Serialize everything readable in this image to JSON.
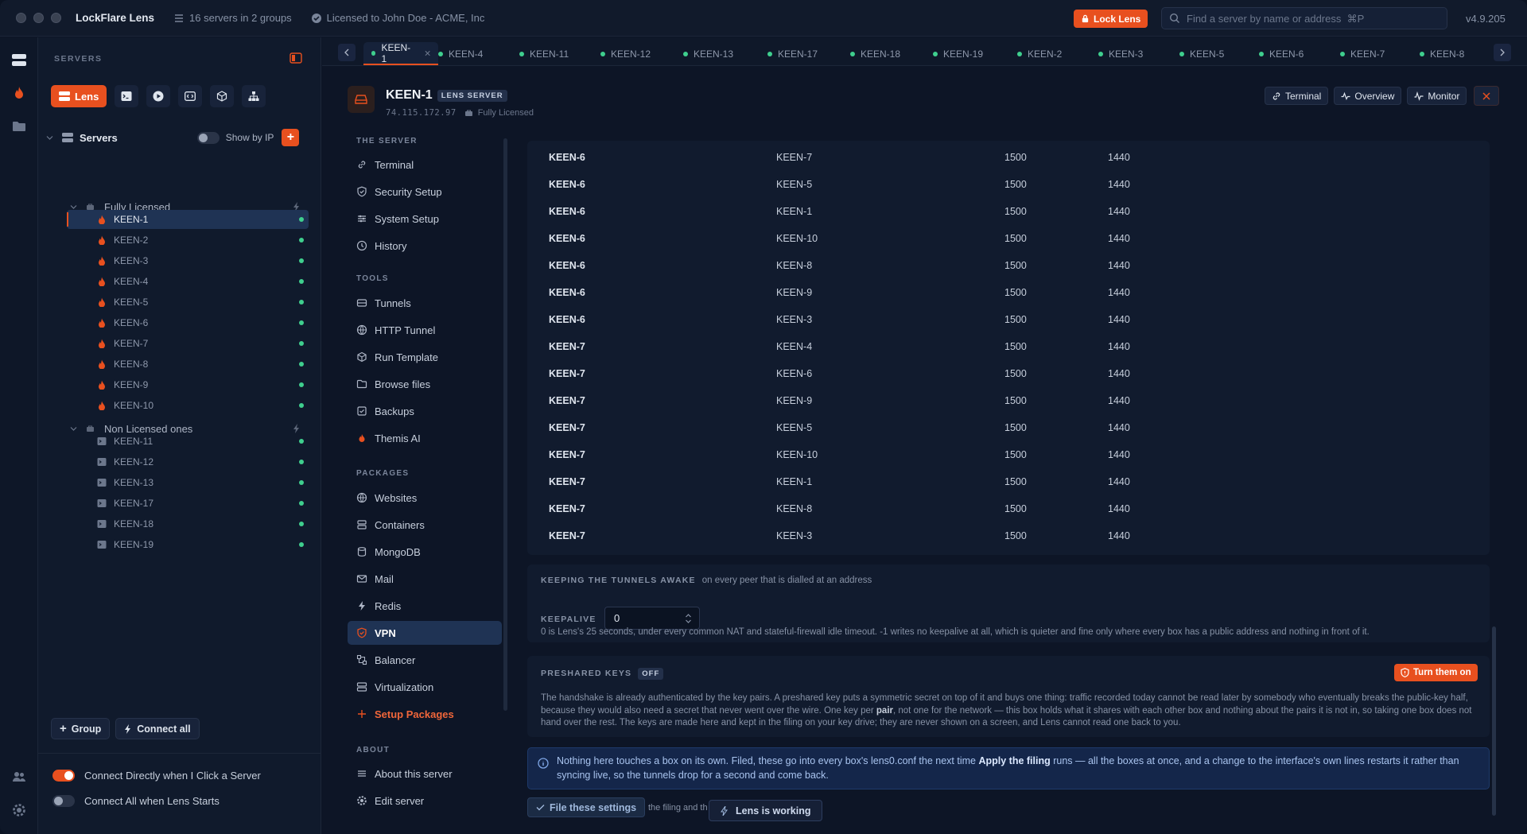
{
  "titlebar": {
    "app_name": "LockFlare Lens",
    "servers_summary": "16 servers in 2 groups",
    "license": "Licensed to John Doe - ACME, Inc",
    "lock_label": "Lock Lens",
    "search_placeholder": "Find a server by name or address  ⌘P",
    "version": "v4.9.205"
  },
  "sidebar": {
    "header": "SERVERS",
    "lens_label": "Lens",
    "servers_label": "Servers",
    "show_by_ip": "Show by IP",
    "groups": [
      {
        "name": "Fully Licensed",
        "items": [
          "KEEN-1",
          "KEEN-2",
          "KEEN-3",
          "KEEN-4",
          "KEEN-5",
          "KEEN-6",
          "KEEN-7",
          "KEEN-8",
          "KEEN-9",
          "KEEN-10"
        ]
      },
      {
        "name": "Non Licensed ones",
        "items": [
          "KEEN-11",
          "KEEN-12",
          "KEEN-13",
          "KEEN-17",
          "KEEN-18",
          "KEEN-19"
        ]
      }
    ],
    "group_btn": "Group",
    "connect_all_btn": "Connect all",
    "toggle_connect_direct": "Connect Directly when I Click a Server",
    "toggle_connect_all": "Connect All when Lens Starts"
  },
  "tabs": [
    "KEEN-1",
    "KEEN-4",
    "KEEN-11",
    "KEEN-12",
    "KEEN-13",
    "KEEN-17",
    "KEEN-18",
    "KEEN-19",
    "KEEN-2",
    "KEEN-3",
    "KEEN-5",
    "KEEN-6",
    "KEEN-7",
    "KEEN-8"
  ],
  "server": {
    "name": "KEEN-1",
    "badge": "LENS SERVER",
    "ip": "74.115.172.97",
    "license": "Fully Licensed",
    "btn_terminal": "Terminal",
    "btn_overview": "Overview",
    "btn_monitor": "Monitor"
  },
  "nav": {
    "sections": {
      "server": "THE SERVER",
      "tools": "TOOLS",
      "packages": "PACKAGES",
      "about": "ABOUT"
    },
    "server_items": [
      "Terminal",
      "Security Setup",
      "System Setup",
      "History"
    ],
    "tools_items": [
      "Tunnels",
      "HTTP Tunnel",
      "Run Template",
      "Browse files",
      "Backups",
      "Themis AI"
    ],
    "packages_items": [
      "Websites",
      "Containers",
      "MongoDB",
      "Mail",
      "Redis",
      "VPN",
      "Balancer",
      "Virtualization"
    ],
    "setup_packages": "Setup Packages",
    "about_items": [
      "About this server",
      "Edit server"
    ]
  },
  "table": {
    "rows": [
      [
        "KEEN-6",
        "KEEN-7",
        "1500",
        "1440"
      ],
      [
        "KEEN-6",
        "KEEN-5",
        "1500",
        "1440"
      ],
      [
        "KEEN-6",
        "KEEN-1",
        "1500",
        "1440"
      ],
      [
        "KEEN-6",
        "KEEN-10",
        "1500",
        "1440"
      ],
      [
        "KEEN-6",
        "KEEN-8",
        "1500",
        "1440"
      ],
      [
        "KEEN-6",
        "KEEN-9",
        "1500",
        "1440"
      ],
      [
        "KEEN-6",
        "KEEN-3",
        "1500",
        "1440"
      ],
      [
        "KEEN-7",
        "KEEN-4",
        "1500",
        "1440"
      ],
      [
        "KEEN-7",
        "KEEN-6",
        "1500",
        "1440"
      ],
      [
        "KEEN-7",
        "KEEN-9",
        "1500",
        "1440"
      ],
      [
        "KEEN-7",
        "KEEN-5",
        "1500",
        "1440"
      ],
      [
        "KEEN-7",
        "KEEN-10",
        "1500",
        "1440"
      ],
      [
        "KEEN-7",
        "KEEN-1",
        "1500",
        "1440"
      ],
      [
        "KEEN-7",
        "KEEN-8",
        "1500",
        "1440"
      ],
      [
        "KEEN-7",
        "KEEN-3",
        "1500",
        "1440"
      ]
    ]
  },
  "keepalive": {
    "title": "KEEPING THE TUNNELS AWAKE",
    "subtitle": "on every peer that is dialled at an address",
    "label": "KEEPALIVE",
    "value": "0",
    "note": "0 is Lens's 25 seconds, under every common NAT and stateful-firewall idle timeout. -1 writes no keepalive at all, which is quieter and fine only where every box has a public address and nothing in front of it."
  },
  "psk": {
    "title": "PRESHARED KEYS",
    "status": "OFF",
    "turn_on": "Turn them on",
    "note_a": "The handshake is already authenticated by the key pairs. A preshared key puts a symmetric secret on top of it and buys one thing: traffic recorded today cannot be read later by somebody who eventually breaks the public-key half, because they would also need a secret that never went over the wire. One key per ",
    "note_pair": "pair",
    "note_b": ", not one for the network — this box holds what it shares with each other box and nothing about the pairs it is not in, so taking one box does not hand over the rest. The keys are made here and kept in the filing on your key drive; they are never shown on a screen, and Lens cannot read one back to you."
  },
  "info": {
    "text_a": "Nothing here touches a box on its own. Filed, these go into every box's lens0.conf the next time ",
    "text_bold": "Apply the filing",
    "text_b": " runs — all the boxes at once, and a change to the interface's own lines restarts it rather than syncing live, so the tunnels drop for a second and come back."
  },
  "footer": {
    "file_btn": "File these settings",
    "file_note": "the filing and th",
    "working": "Lens is working"
  }
}
